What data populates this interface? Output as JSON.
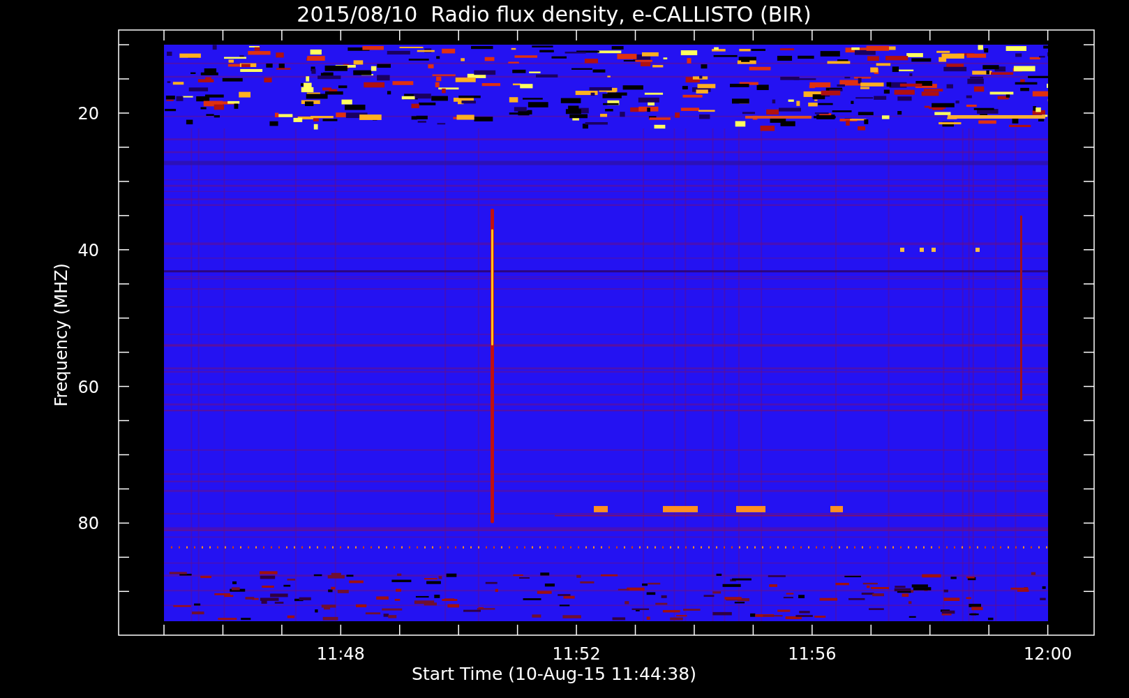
{
  "title": "2015/08/10  Radio flux density, e-CALLISTO (BIR)",
  "plot": {
    "ylabel": "Frequency (MHZ)",
    "xlabel": "Start Time (10-Aug-15 11:44:38)",
    "xticks": [
      {
        "label": "11:48"
      },
      {
        "label": "11:52"
      },
      {
        "label": "11:56"
      },
      {
        "label": "12:00"
      }
    ],
    "yticks": [
      {
        "label": "20"
      },
      {
        "label": "40"
      },
      {
        "label": "60"
      },
      {
        "label": "80"
      }
    ]
  }
}
